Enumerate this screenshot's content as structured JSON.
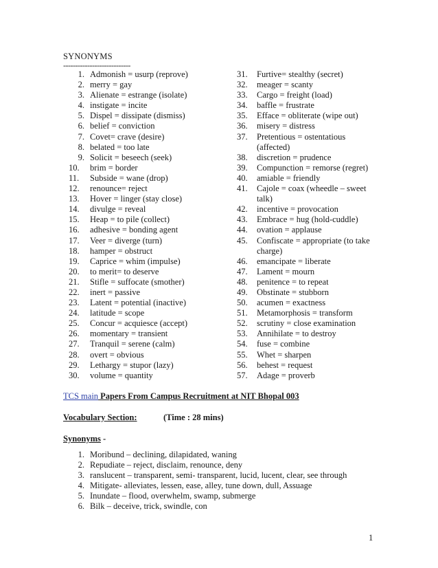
{
  "document": {
    "heading": "SYNONYMS",
    "separator": "----------------------------",
    "left_column": [
      {
        "n": "1.",
        "text": "Admonish = usurp (reprove)"
      },
      {
        "n": "2.",
        "text": "merry = gay"
      },
      {
        "n": "3.",
        "text": "Alienate = estrange (isolate)"
      },
      {
        "n": "4.",
        "text": "instigate = incite"
      },
      {
        "n": "5.",
        "text": "Dispel = dissipate (dismiss)"
      },
      {
        "n": "6.",
        "text": "belief = conviction"
      },
      {
        "n": "7.",
        "text": "Covet= crave (desire)"
      },
      {
        "n": "8.",
        "text": "belated = too late"
      },
      {
        "n": "9.",
        "text": "Solicit = beseech (seek)"
      },
      {
        "n": "10.",
        "text": "brim = border"
      },
      {
        "n": "11.",
        "text": "Subside = wane (drop)"
      },
      {
        "n": "12.",
        "text": "renounce= reject"
      },
      {
        "n": "13.",
        "text": "Hover = linger (stay close)"
      },
      {
        "n": "14.",
        "text": "divulge = reveal"
      },
      {
        "n": "15.",
        "text": "Heap = to pile (collect)"
      },
      {
        "n": "16.",
        "text": "adhesive = bonding agent"
      },
      {
        "n": "17.",
        "text": "Veer = diverge (turn)"
      },
      {
        "n": "18.",
        "text": "hamper = obstruct"
      },
      {
        "n": "19.",
        "text": "Caprice = whim (impulse)"
      },
      {
        "n": "20.",
        "text": "to merit= to deserve"
      },
      {
        "n": "21.",
        "text": "Stifle = suffocate (smother)"
      },
      {
        "n": "22.",
        "text": "inert = passive"
      },
      {
        "n": "23.",
        "text": "Latent = potential (inactive)"
      },
      {
        "n": "24.",
        "text": "latitude = scope"
      },
      {
        "n": "25.",
        "text": "Concur = acquiesce (accept)"
      },
      {
        "n": "26.",
        "text": "momentary = transient"
      },
      {
        "n": "27.",
        "text": "Tranquil = serene (calm)"
      },
      {
        "n": "28.",
        "text": "overt = obvious"
      },
      {
        "n": "29.",
        "text": "Lethargy = stupor (lazy)"
      },
      {
        "n": "30.",
        "text": "volume = quantity"
      }
    ],
    "right_column": [
      {
        "n": "31.",
        "text": "Furtive= stealthy (secret)"
      },
      {
        "n": "32.",
        "text": "meager = scanty"
      },
      {
        "n": "33.",
        "text": "Cargo = freight (load)"
      },
      {
        "n": "34.",
        "text": "baffle = frustrate"
      },
      {
        "n": "35.",
        "text": "Efface = obliterate (wipe out)"
      },
      {
        "n": "36.",
        "text": "misery = distress"
      },
      {
        "n": "37.",
        "text": "Pretentious = ostentatious (affected)"
      },
      {
        "n": "38.",
        "text": "discretion = prudence"
      },
      {
        "n": "39.",
        "text": "Compunction = remorse (regret)"
      },
      {
        "n": "40.",
        "text": "amiable = friendly"
      },
      {
        "n": "41.",
        "text": "Cajole = coax (wheedle – sweet talk)"
      },
      {
        "n": "42.",
        "text": "incentive = provocation"
      },
      {
        "n": "43.",
        "text": "Embrace = hug (hold-cuddle)"
      },
      {
        "n": "44.",
        "text": "ovation = applause"
      },
      {
        "n": "45.",
        "text": "Confiscate = appropriate (to take charge)"
      },
      {
        "n": "46.",
        "text": "emancipate = liberate"
      },
      {
        "n": "47.",
        "text": "Lament = mourn"
      },
      {
        "n": "48.",
        "text": "penitence = to repeat"
      },
      {
        "n": "49.",
        "text": "Obstinate = stubborn"
      },
      {
        "n": "50.",
        "text": "acumen = exactness"
      },
      {
        "n": "51.",
        "text": "Metamorphosis = transform"
      },
      {
        "n": "52.",
        "text": "scrutiny = close examination"
      },
      {
        "n": "53.",
        "text": "Annihilate = to destroy"
      },
      {
        "n": "54.",
        "text": "fuse = combine"
      },
      {
        "n": "55.",
        "text": "Whet = sharpen"
      },
      {
        "n": "56.",
        "text": "behest = request"
      },
      {
        "n": "57.",
        "text": "Adage = proverb"
      }
    ],
    "section": {
      "link_text": "TCS main",
      "title_rest": " Papers From Campus Recruitment at NIT Bhopal 003",
      "vocab_label": "Vocabulary Section:",
      "time_label": "(Time : 28 mins)",
      "synonyms_label": "Synonyms",
      "synonyms_suffix": " -",
      "items": [
        {
          "n": "1.",
          "text": "Moribund – declining, dilapidated, waning"
        },
        {
          "n": "2.",
          "text": "Repudiate – reject, disclaim, renounce, deny"
        },
        {
          "n": "3.",
          "text": "ranslucent – transparent, semi- transparent, lucid, lucent, clear, see through"
        },
        {
          "n": "4.",
          "text": "Mitigate- alleviates, lessen, ease, alley, tune down, dull, Assuage"
        },
        {
          "n": "5.",
          "text": "Inundate – flood, overwhelm, swamp, submerge"
        },
        {
          "n": "6.",
          "text": "Bilk – deceive, trick, swindle, con"
        }
      ]
    },
    "page_number": "1"
  }
}
